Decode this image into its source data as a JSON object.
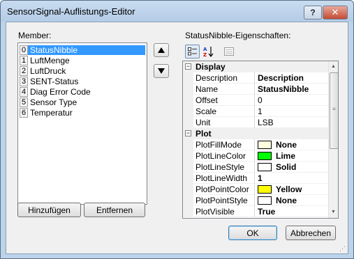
{
  "window": {
    "title": "SensorSignal-Auflistungs-Editor",
    "help_label": "?",
    "close_label": "✕"
  },
  "members": {
    "label": "Member:",
    "items": [
      {
        "index": "0",
        "name": "StatusNibble",
        "selected": true
      },
      {
        "index": "1",
        "name": "LuftMenge"
      },
      {
        "index": "2",
        "name": "LuftDruck"
      },
      {
        "index": "3",
        "name": "SENT-Status"
      },
      {
        "index": "4",
        "name": "Diag Error Code"
      },
      {
        "index": "5",
        "name": "Sensor Type"
      },
      {
        "index": "6",
        "name": "Temperatur"
      }
    ],
    "move_up_icon": "arrow-up-icon",
    "move_down_icon": "arrow-down-icon"
  },
  "buttons": {
    "add": "Hinzufügen",
    "remove": "Entfernen",
    "ok": "OK",
    "cancel": "Abbrechen"
  },
  "properties": {
    "label": "StatusNibble-Eigenschaften:",
    "toolbar": [
      "categorized-icon",
      "alphabetical-icon",
      "property-pages-icon"
    ],
    "categories": [
      {
        "name": "Display",
        "expanded": true,
        "rows": [
          {
            "name": "Description",
            "value": "Description",
            "bold": true
          },
          {
            "name": "Name",
            "value": "StatusNibble",
            "bold": true
          },
          {
            "name": "Offset",
            "value": "0"
          },
          {
            "name": "Scale",
            "value": "1"
          },
          {
            "name": "Unit",
            "value": "LSB"
          }
        ]
      },
      {
        "name": "Plot",
        "expanded": true,
        "rows": [
          {
            "name": "PlotFillMode",
            "value": "None",
            "bold": true,
            "swatch": "#ffffe0"
          },
          {
            "name": "PlotLineColor",
            "value": "Lime",
            "bold": true,
            "swatch": "#00ff00"
          },
          {
            "name": "PlotLineStyle",
            "value": "Solid",
            "bold": true,
            "swatch": "#ffffff"
          },
          {
            "name": "PlotLineWidth",
            "value": "1",
            "bold": true
          },
          {
            "name": "PlotPointColor",
            "value": "Yellow",
            "bold": true,
            "swatch": "#ffff00"
          },
          {
            "name": "PlotPointStyle",
            "value": "None",
            "bold": true,
            "swatch": "#ffffff"
          },
          {
            "name": "PlotVisible",
            "value": "True",
            "bold": true
          }
        ]
      }
    ]
  },
  "colors": {
    "selection": "#3399ff",
    "title_bar": "#b4cce6"
  }
}
